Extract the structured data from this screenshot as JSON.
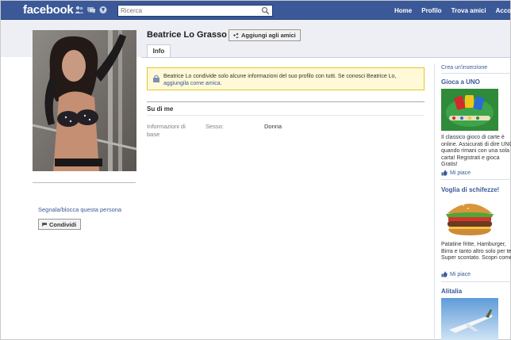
{
  "topbar": {
    "logo": "facebook",
    "search_placeholder": "Ricerca",
    "nav": [
      "Home",
      "Profilo",
      "Trova amici",
      "Account"
    ]
  },
  "profile": {
    "name": "Beatrice Lo Grasso",
    "add_friend_label": "Aggiungi agli amici",
    "tab_info": "Info",
    "report_link": "Segnala/blocca questa persona",
    "share_label": "Condividi"
  },
  "notice": {
    "text": "Beatrice Lo condivide solo alcune informazioni del suo profilo con tutti. Se conosci Beatrice Lo, ",
    "link": "aggiungila come amica."
  },
  "about": {
    "title": "Su di me",
    "basic_info_label": "Informazioni di base",
    "sex_label": "Sesso:",
    "sex_value": "Donna"
  },
  "ads": {
    "create_ad": "Crea un'inserzione",
    "items": [
      {
        "title": "Gioca a UNO",
        "text": "Il classico gioco di carte è online. Assicurati di dire UNO quando rimani con una sola carta! Registrati e gioca Gratis!",
        "like": "Mi piace"
      },
      {
        "title": "Voglia di schifezze!",
        "text": "Patatine fritte, Hamburger, Birra e tanto altro solo per te! Super scontato. Scopri come!",
        "like": "Mi piace"
      },
      {
        "title": "Alitalia"
      }
    ]
  },
  "colors": {
    "brand_blue": "#3b5998",
    "notice_bg": "#fff9d7",
    "notice_border": "#e2c822"
  }
}
